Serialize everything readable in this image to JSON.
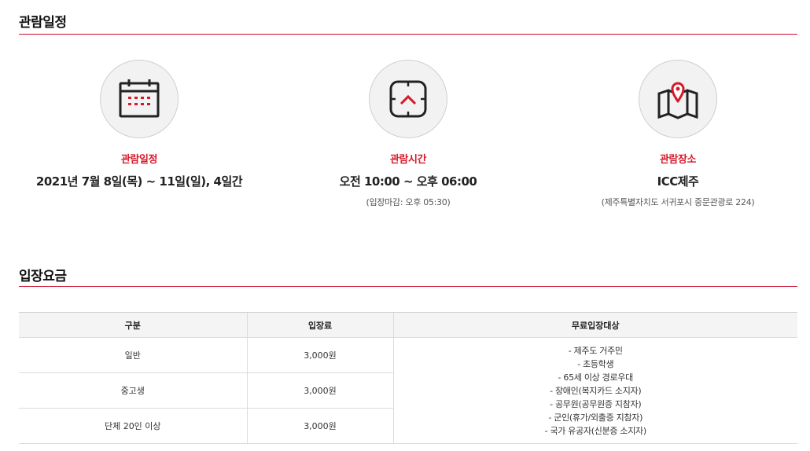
{
  "schedule_section": {
    "title": "관람일정",
    "items": [
      {
        "icon": "calendar-icon",
        "label": "관람일정",
        "value": "2021년 7월 8일(목) ~ 11일(일), 4일간",
        "sub": ""
      },
      {
        "icon": "clock-icon",
        "label": "관람시간",
        "value": "오전 10:00 ~ 오후 06:00",
        "sub": "(입장마감: 오후 05:30)"
      },
      {
        "icon": "map-pin-icon",
        "label": "관람장소",
        "value": "ICC제주",
        "sub": "(제주특별자치도 서귀포시 중문관광로 224)"
      }
    ]
  },
  "fee_section": {
    "title": "입장요금",
    "headers": [
      "구분",
      "입장료",
      "무료입장대상"
    ],
    "rows": [
      {
        "category": "일반",
        "price": "3,000원"
      },
      {
        "category": "중고생",
        "price": "3,000원"
      },
      {
        "category": "단체 20인 이상",
        "price": "3,000원"
      }
    ],
    "free_targets": [
      "- 제주도 거주민",
      "- 초등학생",
      "- 65세 이상 경로우대",
      "- 장애인(복지카드 소지자)",
      "- 공무원(공무원증 지참자)",
      "- 군인(휴가/외출증 지참자)",
      "- 국가 유공자(신분증 소지자)"
    ]
  },
  "colors": {
    "accent": "#d7182a",
    "rule": "#c8102e",
    "icon_stroke": "#222222"
  }
}
